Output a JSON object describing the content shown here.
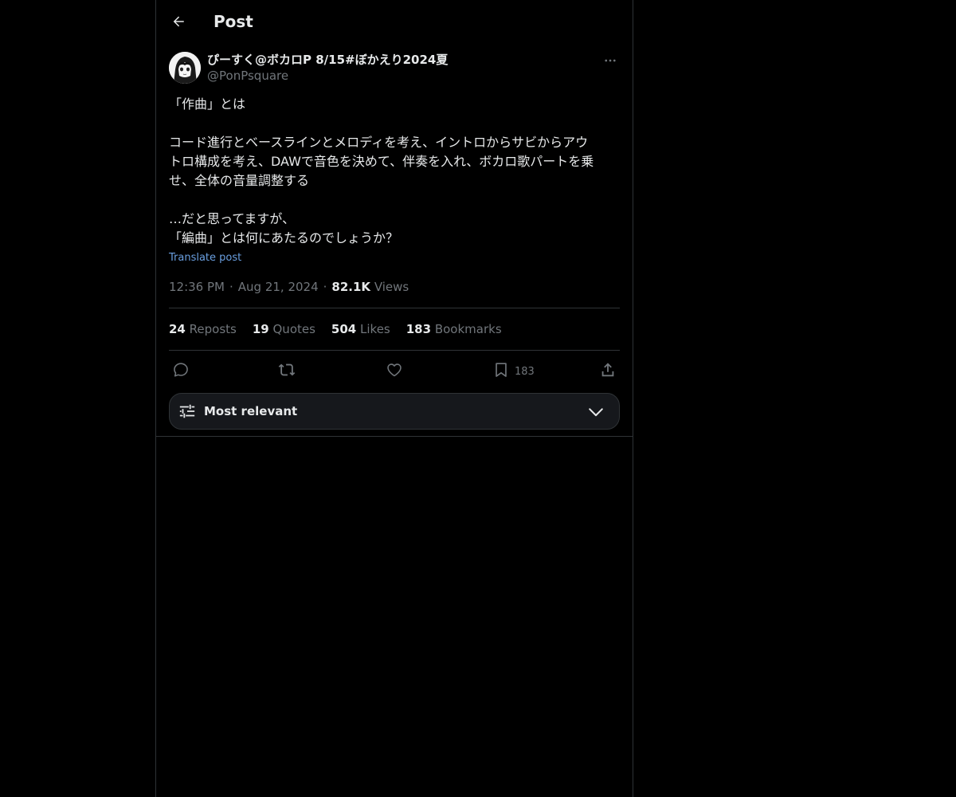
{
  "header": {
    "title": "Post",
    "back_icon": "arrow-left-icon"
  },
  "post": {
    "author_name": "ぴーすく@ボカロP 8/15#ぼかえり2024夏",
    "author_handle": "@PonPsquare",
    "text_lines": [
      "「作曲」とは",
      "",
      "コード進行とベースラインとメロディを考え、イントロからサビからアウ",
      "トロ構成を考え、DAWで音色を決めて、伴奏を入れ、ボカロ歌パートを乗",
      "せ、全体の音量調整する",
      "",
      "…だと思ってますが、",
      "「編曲」とは何にあたるのでしょうか？"
    ],
    "translate_label": "Translate post",
    "time": "12:36 PM",
    "date": "Aug 21, 2024",
    "views_count": "82.1K",
    "views_label": "Views"
  },
  "stats": {
    "reposts_count": "24",
    "reposts_label": "Reposts",
    "quotes_count": "19",
    "quotes_label": "Quotes",
    "likes_count": "504",
    "likes_label": "Likes",
    "bookmarks_count": "183",
    "bookmarks_label": "Bookmarks"
  },
  "actions": {
    "bookmark_count": "183"
  },
  "sort": {
    "label": "Most relevant"
  },
  "colors": {
    "background": "#000000",
    "text": "#e7e9ea",
    "muted": "#71767b",
    "link": "#6a9fe0",
    "border": "#2f3336"
  }
}
